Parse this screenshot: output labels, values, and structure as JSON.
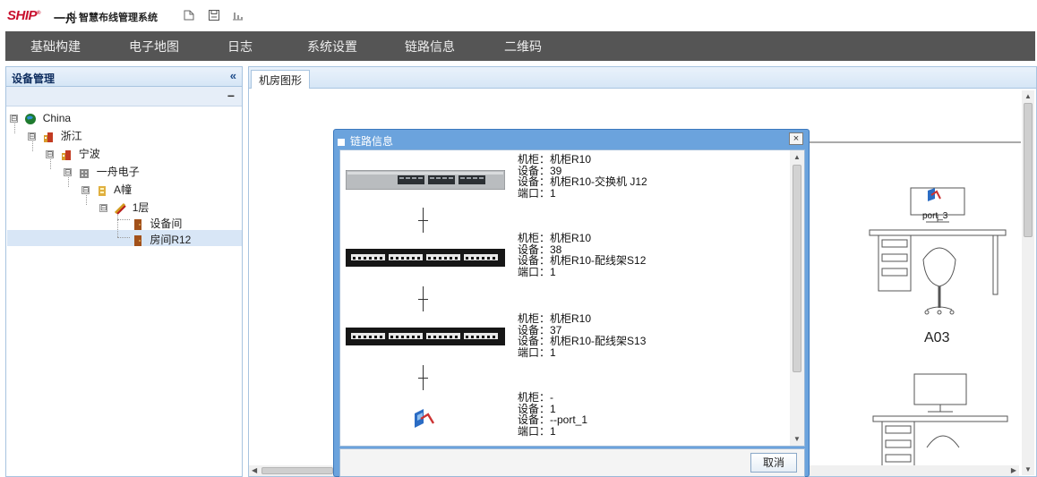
{
  "app": {
    "logo": "SHIP",
    "logo_mark": "®",
    "brand": "一舟",
    "title": "智慧布线管理系统"
  },
  "toolbar_icons": [
    "export-icon",
    "save-icon",
    "chart-icon"
  ],
  "menu": {
    "items": [
      "基础构建",
      "电子地图",
      "日志",
      "系统设置",
      "链路信息",
      "二维码"
    ]
  },
  "left_panel": {
    "title": "设备管理",
    "collapse_glyph": "«",
    "minimize_glyph": "−",
    "tree": [
      {
        "label": "China",
        "toggle": "⊟",
        "icon": "globe-icon"
      },
      {
        "label": "浙江",
        "toggle": "⊟",
        "icon": "building-icon"
      },
      {
        "label": "宁波",
        "toggle": "⊟",
        "icon": "building-icon"
      },
      {
        "label": "一舟电子",
        "toggle": "⊟",
        "icon": "company-icon"
      },
      {
        "label": "A幢",
        "toggle": "⊟",
        "icon": "tower-icon"
      },
      {
        "label": "1层",
        "toggle": "⊟",
        "icon": "floor-icon"
      },
      {
        "label": "设备间",
        "icon": "room-icon"
      },
      {
        "label": "房间R12",
        "icon": "room-icon",
        "selected": true
      }
    ]
  },
  "tabs": [
    {
      "label": "机房图形",
      "active": true
    }
  ],
  "canvas": {
    "port_label": "port_3",
    "seat_label": "A03"
  },
  "dialog": {
    "title": "链路信息",
    "close_glyph": "×",
    "cancel_label": "取消",
    "entries": [
      {
        "cabinet": "机柜：机柜R10",
        "device_no": "设备：39",
        "device": "设备：机柜R10-交换机 J12",
        "port": "端口：1",
        "type": "switch"
      },
      {
        "cabinet": "机柜：机柜R10",
        "device_no": "设备：38",
        "device": "设备：机柜R10-配线架S12",
        "port": "端口：1",
        "type": "patch-panel"
      },
      {
        "cabinet": "机柜：机柜R10",
        "device_no": "设备：37",
        "device": "设备：机柜R10-配线架S13",
        "port": "端口：1",
        "type": "patch-panel"
      },
      {
        "cabinet": "机柜：-",
        "device_no": "设备：1",
        "device": "设备：--port_1",
        "port": "端口：1",
        "type": "wall-port"
      }
    ]
  },
  "colors": {
    "menubar": "#555555",
    "logo_red": "#c8102e",
    "dialog_frame": "#6ba3dd",
    "panel_border": "#a8c4e0",
    "selection": "#d8e6f6"
  }
}
